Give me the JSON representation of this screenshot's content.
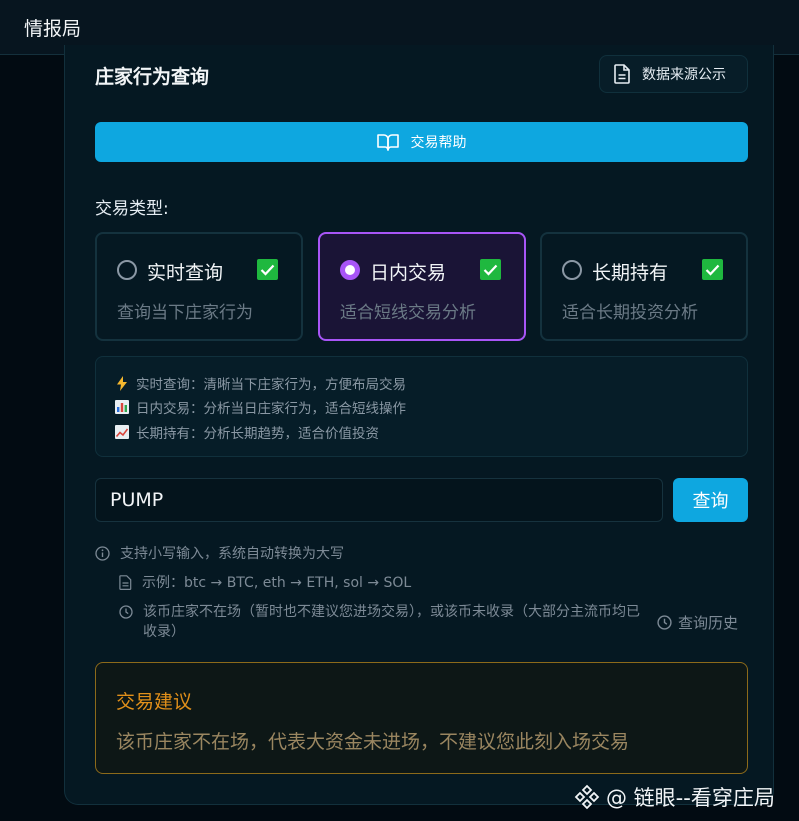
{
  "app": {
    "title": "情报局"
  },
  "header": {
    "title": "庄家行为查询",
    "source_button": "数据来源公示",
    "help_button": "交易帮助"
  },
  "trade_type": {
    "label": "交易类型:",
    "options": [
      {
        "name": "实时查询",
        "desc": "查询当下庄家行为",
        "selected": false,
        "checked": true
      },
      {
        "name": "日内交易",
        "desc": "适合短线交易分析",
        "selected": true,
        "checked": true
      },
      {
        "name": "长期持有",
        "desc": "适合长期投资分析",
        "selected": false,
        "checked": true
      }
    ]
  },
  "info": {
    "lines": [
      {
        "icon": "lightning-icon",
        "text": "实时查询：清晰当下庄家行为，方便布局交易"
      },
      {
        "icon": "bar-chart-icon",
        "text": "日内交易：分析当日庄家行为，适合短线操作"
      },
      {
        "icon": "trend-up-icon",
        "text": "长期持有：分析长期趋势，适合价值投资"
      }
    ]
  },
  "search": {
    "value": "PUMP",
    "button": "查询"
  },
  "hints": {
    "case_note": "支持小写输入，系统自动转换为大写",
    "example": "示例：btc → BTC, eth → ETH, sol → SOL",
    "absent_note": "该币庄家不在场（暂时也不建议您进场交易），或该币未收录（大部分主流币均已收录）",
    "history_button": "查询历史"
  },
  "advice": {
    "title": "交易建议",
    "text": "该币庄家不在场，代表大资金未进场，不建议您此刻入场交易"
  },
  "watermark": {
    "text": "@ 链眼--看穿庄局"
  },
  "colors": {
    "accent_blue": "#0ea7e0",
    "selected_purple": "#a855f7",
    "check_green": "#1fb83f",
    "advice_orange": "#e08f1a"
  }
}
